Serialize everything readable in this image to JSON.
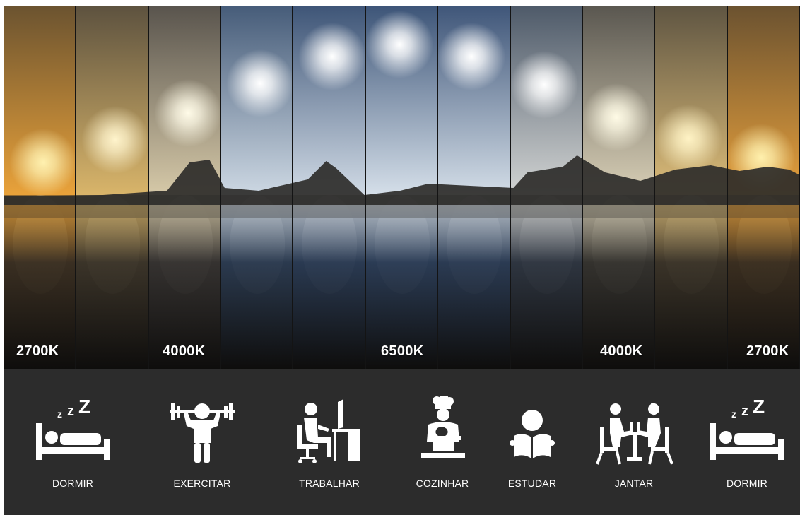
{
  "temperature_labels": [
    "2700K",
    "4000K",
    "6500K",
    "4000K",
    "2700K"
  ],
  "activities": [
    {
      "label": "DORMIR",
      "icon": "sleeping-bed-icon"
    },
    {
      "label": "EXERCITAR",
      "icon": "weightlifting-icon"
    },
    {
      "label": "TRABALHAR",
      "icon": "desk-computer-icon"
    },
    {
      "label": "COZINHAR",
      "icon": "chef-cooking-icon"
    },
    {
      "label": "ESTUDAR",
      "icon": "reading-book-icon"
    },
    {
      "label": "JANTAR",
      "icon": "dinner-couple-icon"
    },
    {
      "label": "DORMIR",
      "icon": "sleeping-bed-icon"
    }
  ],
  "strip_colors": [
    {
      "sky_top": "#6b5330",
      "sky_bottom": "#e9a23a",
      "sun": "#fff1b0",
      "water": "#3a2f22"
    },
    {
      "sky_top": "#5d523f",
      "sky_bottom": "#d9b56a",
      "sun": "#fff4cc",
      "water": "#3b3429"
    },
    {
      "sky_top": "#59544d",
      "sky_bottom": "#d6c9a8",
      "sun": "#fffbe8",
      "water": "#353230"
    },
    {
      "sky_top": "#465c79",
      "sky_bottom": "#cdd8e3",
      "sun": "#ffffff",
      "water": "#2b3a4f"
    },
    {
      "sky_top": "#3e5577",
      "sky_bottom": "#d0dae5",
      "sun": "#ffffff",
      "water": "#2a3a52"
    },
    {
      "sky_top": "#3d5578",
      "sky_bottom": "#d5dfe9",
      "sun": "#ffffff",
      "water": "#2b3c55"
    },
    {
      "sky_top": "#3f5679",
      "sky_bottom": "#d3dde7",
      "sun": "#ffffff",
      "water": "#2b3b53"
    },
    {
      "sky_top": "#4e5a69",
      "sky_bottom": "#d2d4d3",
      "sun": "#ffffff",
      "water": "#2e3540"
    },
    {
      "sky_top": "#5a5750",
      "sky_bottom": "#d8cfb6",
      "sun": "#fffbe6",
      "water": "#34322e"
    },
    {
      "sky_top": "#5f5542",
      "sky_bottom": "#ddbd79",
      "sun": "#fff3c5",
      "water": "#3a3328"
    },
    {
      "sky_top": "#6b5230",
      "sky_bottom": "#e6a03c",
      "sun": "#fff0ad",
      "water": "#3a2e20"
    }
  ]
}
